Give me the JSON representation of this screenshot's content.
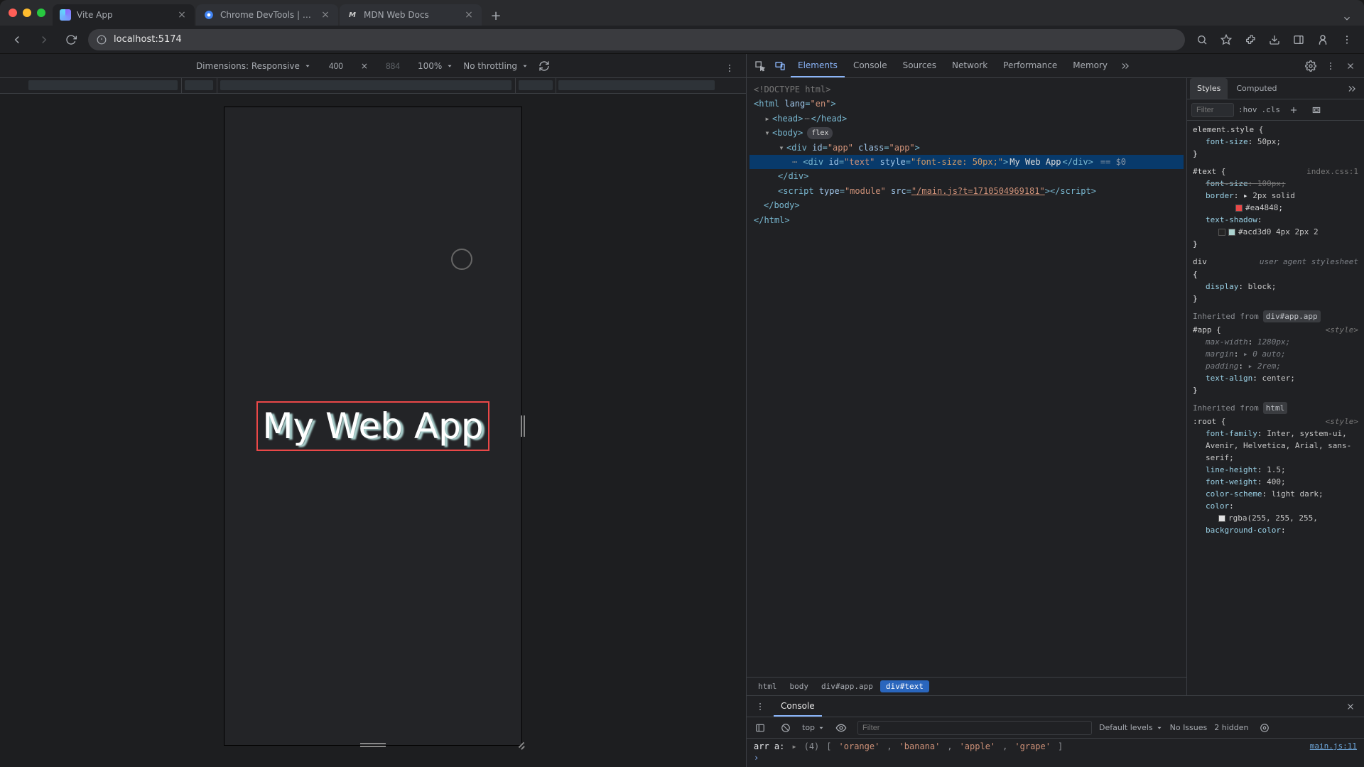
{
  "tabs": [
    {
      "title": "Vite App",
      "favcolor": "#8b6bff"
    },
    {
      "title": "Chrome DevTools | Chrome",
      "favcolor": "#3cba54"
    },
    {
      "title": "MDN Web Docs",
      "favcolor": "#ccc",
      "favtext": "M"
    }
  ],
  "url": "localhost:5174",
  "device": {
    "dimensions_label": "Dimensions: Responsive",
    "width": "400",
    "height": "884",
    "zoom": "100%",
    "throttle": "No throttling"
  },
  "page": {
    "app_text": "My Web App"
  },
  "devtools": {
    "tabs": [
      "Elements",
      "Console",
      "Sources",
      "Network",
      "Performance",
      "Memory"
    ],
    "active_tab": "Elements",
    "styletabs": [
      "Styles",
      "Computed"
    ],
    "styletab_active": "Styles",
    "filter_placeholder": "Filter",
    "hov": ":hov",
    "cls": ".cls",
    "dom": {
      "doctype": "<!DOCTYPE html>",
      "html_open": "<html lang=\"en\">",
      "head": "<head> … </head>",
      "body_open": "<body>",
      "flex_pill": "flex",
      "app_open": "<div id=\"app\" class=\"app\">",
      "text_line_pre": "<div id=\"text\" style=\"font-size: 50px;\">",
      "text_content": "My Web App",
      "text_line_post": "</div>",
      "eq": "== $0",
      "app_close": "</div>",
      "script": "<script type=\"module\" src=\"/main.js?t=1710504969181\"></script>",
      "body_close": "</body>",
      "html_close": "</html>"
    },
    "crumbs": [
      "html",
      "body",
      "div#app.app",
      "div#text"
    ],
    "crumb_sel": "div#text",
    "styles": {
      "element_style": {
        "selector": "element.style {",
        "props": [
          [
            "font-size",
            "50px;"
          ]
        ]
      },
      "text_rule": {
        "selector": "#text {",
        "src": "index.css:1",
        "props": [
          [
            "font-size",
            "100px;",
            true
          ],
          [
            "border",
            "2px solid"
          ],
          [
            "border_color",
            "#ea4848"
          ],
          [
            "text-shadow",
            ""
          ],
          [
            "shadow_val",
            "#acd3d0 4px 2px 2"
          ]
        ]
      },
      "ua_div": {
        "selector": "div",
        "note": "user agent stylesheet",
        "props": [
          [
            "display",
            "block;"
          ]
        ]
      },
      "inh_app_label": "Inherited from",
      "inh_app_sel": "div#app.app",
      "app_rule": {
        "selector": "#app {",
        "src": "<style>",
        "props": [
          [
            "max-width",
            "1280px;"
          ],
          [
            "margin",
            "▸ 0 auto;"
          ],
          [
            "padding",
            "▸ 2rem;"
          ],
          [
            "text-align",
            "center;"
          ]
        ]
      },
      "inh_html_label": "Inherited from",
      "inh_html_sel": "html",
      "root_rule": {
        "selector": ":root {",
        "src": "<style>",
        "props": [
          [
            "font-family",
            "Inter, system-ui, Avenir, Helvetica, Arial, sans-serif;"
          ],
          [
            "line-height",
            "1.5;"
          ],
          [
            "font-weight",
            "400;"
          ],
          [
            "color-scheme",
            "light dark;"
          ],
          [
            "color",
            ""
          ],
          [
            "color_val",
            "rgba(255, 255, 255,"
          ],
          [
            "background-color",
            ""
          ]
        ]
      }
    }
  },
  "console": {
    "tab": "Console",
    "context": "top",
    "levels": "Default levels",
    "issues": "No Issues",
    "hidden": "2 hidden",
    "filter_placeholder": "Filter",
    "log_label": "arr a:",
    "log_count": "(4)",
    "log_items": [
      "'orange'",
      "'banana'",
      "'apple'",
      "'grape'"
    ],
    "src": "main.js:11"
  }
}
